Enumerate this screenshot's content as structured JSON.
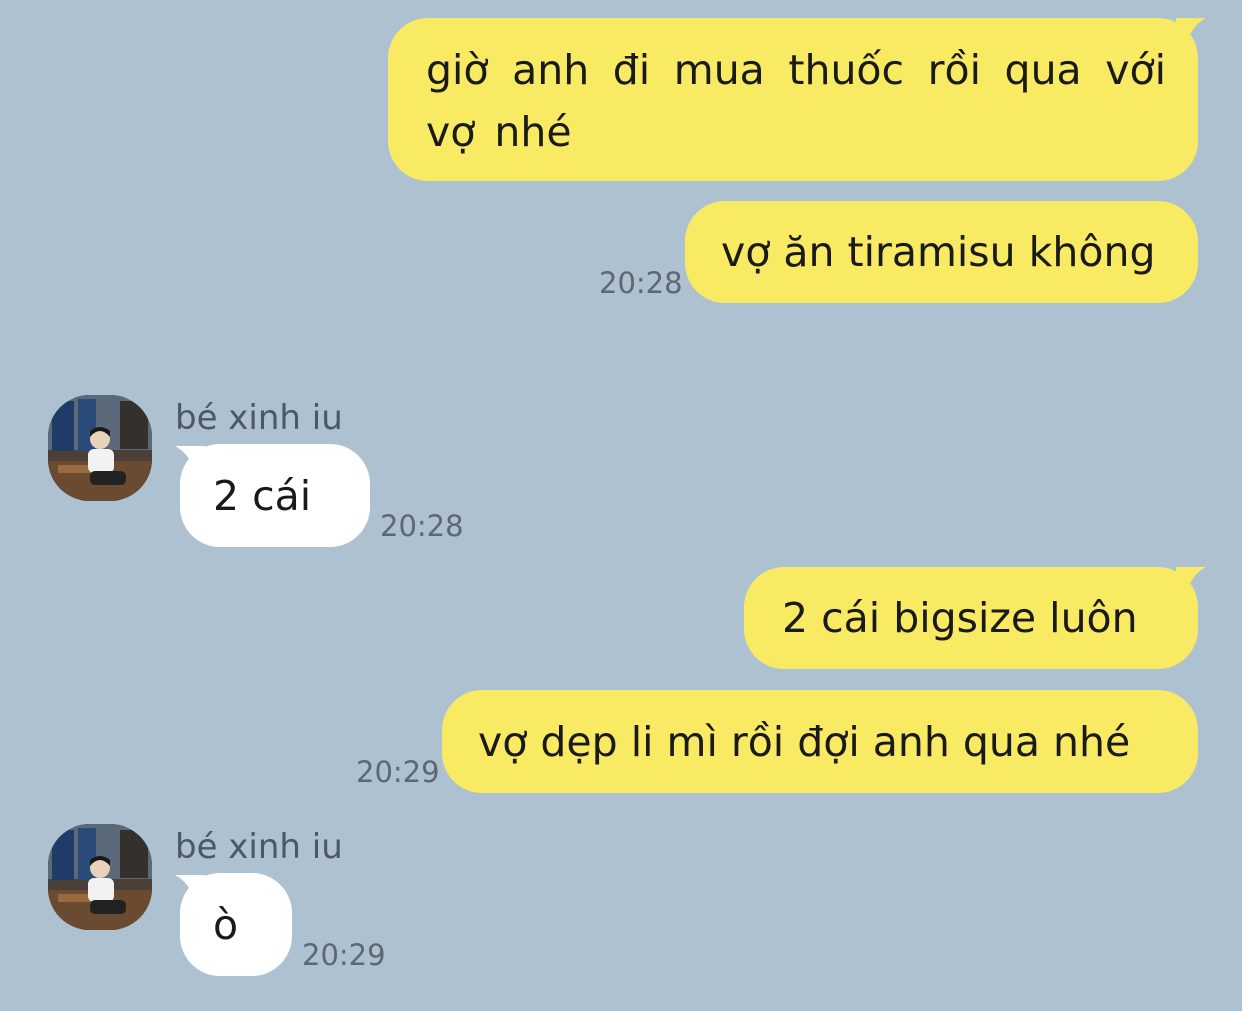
{
  "colors": {
    "background": "#adc1d1",
    "outgoing_bubble": "#f9ea63",
    "incoming_bubble": "#ffffff",
    "timestamp": "#5e6872",
    "sender_name": "#4e5862"
  },
  "messages": [
    {
      "direction": "outgoing",
      "text": "giờ anh đi mua thuốc rồi qua với vợ nhé",
      "time": ""
    },
    {
      "direction": "outgoing",
      "text": "vợ ăn tiramisu không",
      "time": "20:28"
    },
    {
      "direction": "incoming",
      "sender": "bé xinh iu",
      "avatar_icon": "contact-photo",
      "text": "2 cái",
      "time": "20:28"
    },
    {
      "direction": "outgoing",
      "text": "2 cái bigsize luôn",
      "time": ""
    },
    {
      "direction": "outgoing",
      "text": "vợ dẹp li mì rồi đợi anh qua nhé",
      "time": "20:29"
    },
    {
      "direction": "incoming",
      "sender": "bé xinh iu",
      "avatar_icon": "contact-photo",
      "text": "ò",
      "time": "20:29"
    }
  ]
}
